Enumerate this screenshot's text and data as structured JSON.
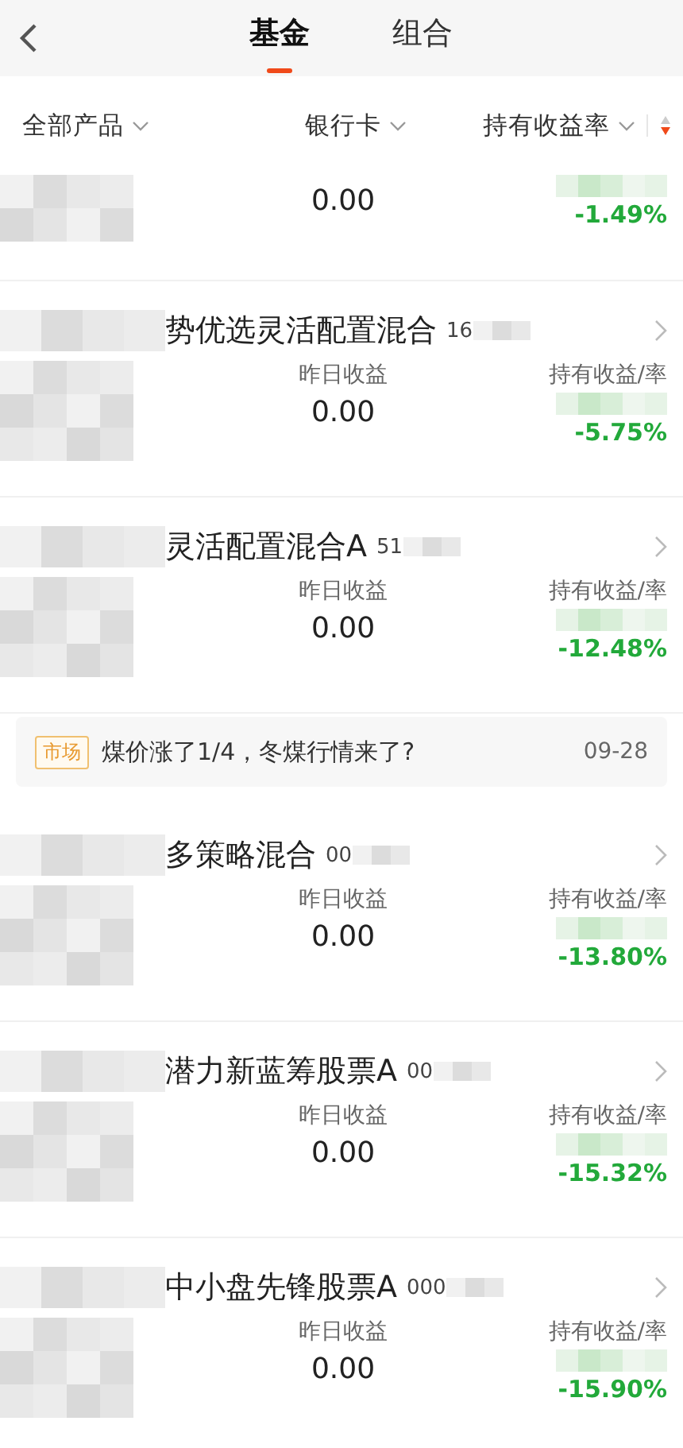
{
  "header": {
    "tabs": [
      {
        "label": "基金",
        "selected": true
      },
      {
        "label": "组合",
        "selected": false
      }
    ]
  },
  "filters": [
    {
      "label": "全部产品"
    },
    {
      "label": "银行卡"
    },
    {
      "label": "持有收益率"
    }
  ],
  "items": [
    {
      "kind": "partial",
      "yesterday_value": "0.00",
      "rate": "-1.49%"
    },
    {
      "kind": "fund",
      "name": "势优选灵活配置混合",
      "code": "16",
      "yesterday_label": "昨日收益",
      "yesterday_value": "0.00",
      "holding_label": "持有收益/率",
      "rate": "-5.75%"
    },
    {
      "kind": "fund",
      "name": "灵活配置混合A",
      "code": "51",
      "yesterday_label": "昨日收益",
      "yesterday_value": "0.00",
      "holding_label": "持有收益/率",
      "rate": "-12.48%"
    },
    {
      "kind": "news",
      "tag": "市场",
      "title": "煤价涨了1/4，冬煤行情来了?",
      "date": "09-28"
    },
    {
      "kind": "fund",
      "name": "多策略混合",
      "code": "00",
      "yesterday_label": "昨日收益",
      "yesterday_value": "0.00",
      "holding_label": "持有收益/率",
      "rate": "-13.80%"
    },
    {
      "kind": "fund",
      "name": "潜力新蓝筹股票A",
      "code": "00",
      "yesterday_label": "昨日收益",
      "yesterday_value": "0.00",
      "holding_label": "持有收益/率",
      "rate": "-15.32%"
    },
    {
      "kind": "fund",
      "name": "中小盘先锋股票A",
      "code": "000",
      "yesterday_label": "昨日收益",
      "yesterday_value": "0.00",
      "holding_label": "持有收益/率",
      "rate": "-15.90%"
    }
  ]
}
